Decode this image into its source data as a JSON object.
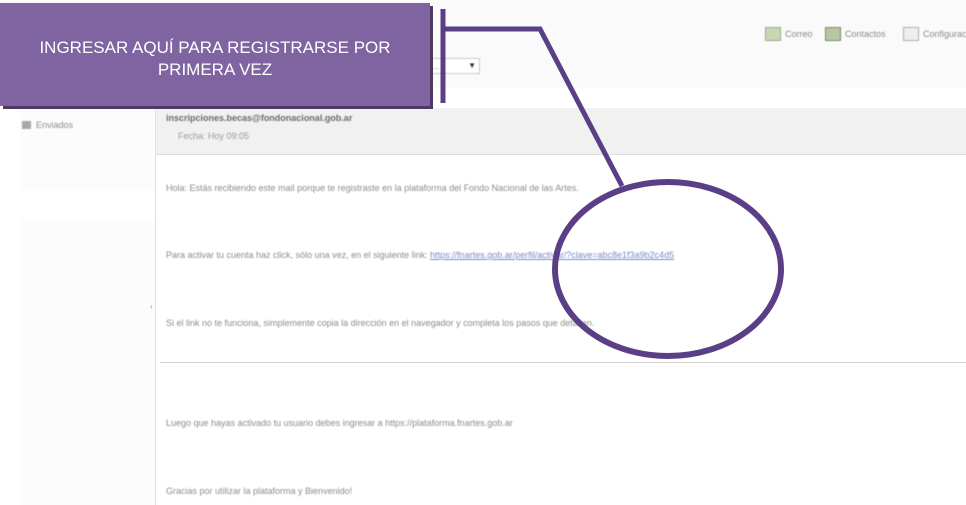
{
  "callout": {
    "line1": "INGRESAR AQUÍ PARA REGISTRARSE POR",
    "line2": "PRIMERA VEZ"
  },
  "toolbar": {
    "items": [
      {
        "label": "Correo",
        "icon": "mail-icon"
      },
      {
        "label": "Contactos",
        "icon": "contacts-icon"
      },
      {
        "label": "Configurac",
        "icon": "settings-icon"
      }
    ],
    "dropdown_value": "..."
  },
  "sidebar": {
    "folder_label": "Enviados"
  },
  "message": {
    "sender": "inscripciones.becas@fondonacional.gob.ar",
    "date": "Fecha: Hoy 09:05",
    "line1": "Hola: Estás recibiendo este mail porque te registraste en la plataforma del Fondo Nacional de las Artes.",
    "line2_prefix": "Para activar tu cuenta haz click, sólo una vez, en el siguiente link:",
    "line2_link": "https://fnartes.gob.ar/perfil/activar/?clave=abc8e1f3a9b2c4d5",
    "line3": "Si el link no te funciona, simplemente copia la dirección en el navegador y completa los pasos que detallan.",
    "line4": "Luego que hayas activado tu usuario debes ingresar a https://plataforma.fnartes.gob.ar",
    "line5": "Gracias por utilizar la plataforma y Bienvenido!"
  },
  "colors": {
    "callout_bg": "#8064a2",
    "annotation": "#5b3f86"
  }
}
